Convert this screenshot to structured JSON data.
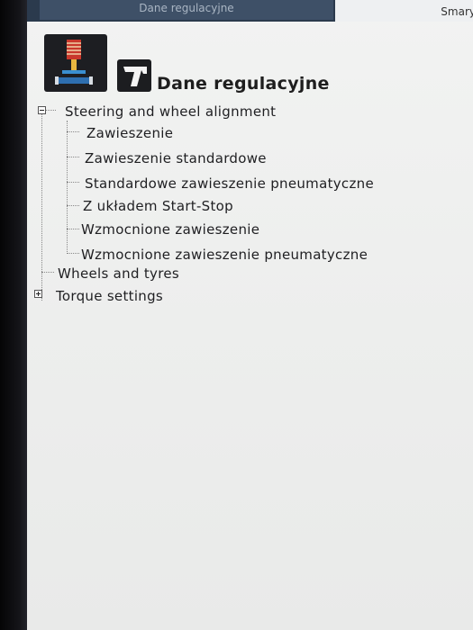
{
  "tabs": [
    {
      "label": "Dane regulacyjne"
    },
    {
      "label": "Smary"
    }
  ],
  "header": {
    "title": "Dane regulacyjne"
  },
  "tree": {
    "steering": {
      "label": "Steering and wheel alignment",
      "children": [
        {
          "label": "Zawieszenie"
        },
        {
          "label": "Zawieszenie standardowe"
        },
        {
          "label": "Standardowe zawieszenie pneumatyczne"
        },
        {
          "label": "Z układem Start-Stop"
        },
        {
          "label": "Wzmocnione zawieszenie"
        },
        {
          "label": "Wzmocnione zawieszenie pneumatyczne"
        }
      ]
    },
    "wheels": {
      "label": "Wheels and tyres"
    },
    "torque": {
      "label": "Torque settings"
    }
  },
  "colors": {
    "tabbar": "#2b3a4d",
    "background": "#eeefee",
    "text": "#1f1f22"
  }
}
